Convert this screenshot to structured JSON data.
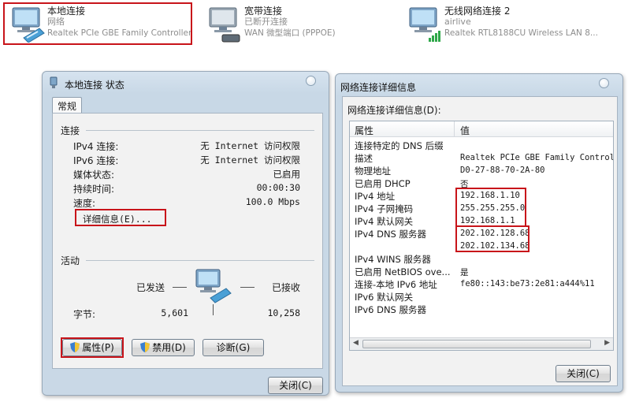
{
  "adapters": [
    {
      "name": "本地连接",
      "status": "网络",
      "device": "Realtek PCIe GBE Family Controller"
    },
    {
      "name": "宽带连接",
      "status": "已断开连接",
      "device": "WAN 微型端口 (PPPOE)"
    },
    {
      "name": "无线网络连接 2",
      "status": "airlive",
      "device": "Realtek RTL8188CU Wireless LAN 8..."
    }
  ],
  "status_window": {
    "title": "本地连接 状态",
    "tab": "常规",
    "connection_group": "连接",
    "rows": [
      {
        "label": "IPv4 连接:",
        "value": "无 Internet 访问权限"
      },
      {
        "label": "IPv6 连接:",
        "value": "无 Internet 访问权限"
      },
      {
        "label": "媒体状态:",
        "value": "已启用"
      },
      {
        "label": "持续时间:",
        "value": "00:00:30"
      },
      {
        "label": "速度:",
        "value": "100.0 Mbps"
      }
    ],
    "details_button": "详细信息(E)...",
    "activity_group": "活动",
    "sent_label": "已发送",
    "received_label": "已接收",
    "bytes_label": "字节:",
    "bytes_sent": "5,601",
    "bytes_received": "10,258",
    "properties_button": "属性(P)",
    "disable_button": "禁用(D)",
    "diagnose_button": "诊断(G)",
    "close_button": "关闭(C)"
  },
  "details_window": {
    "title": "网络连接详细信息",
    "list_label": "网络连接详细信息(D):",
    "col_property": "属性",
    "col_value": "值",
    "rows": [
      {
        "property": "连接特定的 DNS 后缀",
        "value": ""
      },
      {
        "property": "描述",
        "value": "Realtek PCIe GBE Family Controlle"
      },
      {
        "property": "物理地址",
        "value": "D0-27-88-70-2A-80"
      },
      {
        "property": "已启用 DHCP",
        "value": "否"
      },
      {
        "property": "IPv4 地址",
        "value": "192.168.1.10"
      },
      {
        "property": "IPv4 子网掩码",
        "value": "255.255.255.0"
      },
      {
        "property": "IPv4 默认网关",
        "value": "192.168.1.1"
      },
      {
        "property": "IPv4 DNS 服务器",
        "value": "202.102.128.68"
      },
      {
        "property": "",
        "value": "202.102.134.68"
      },
      {
        "property": "IPv4 WINS 服务器",
        "value": ""
      },
      {
        "property": "已启用 NetBIOS ove...",
        "value": "是"
      },
      {
        "property": "连接-本地 IPv6 地址",
        "value": "fe80::143:be73:2e81:a444%11"
      },
      {
        "property": "IPv6 默认网关",
        "value": ""
      },
      {
        "property": "IPv6 DNS 服务器",
        "value": ""
      }
    ],
    "close_button": "关闭(C)"
  },
  "colors": {
    "highlight_red": "#c8141a",
    "window_frame": "#c9d8e6"
  }
}
